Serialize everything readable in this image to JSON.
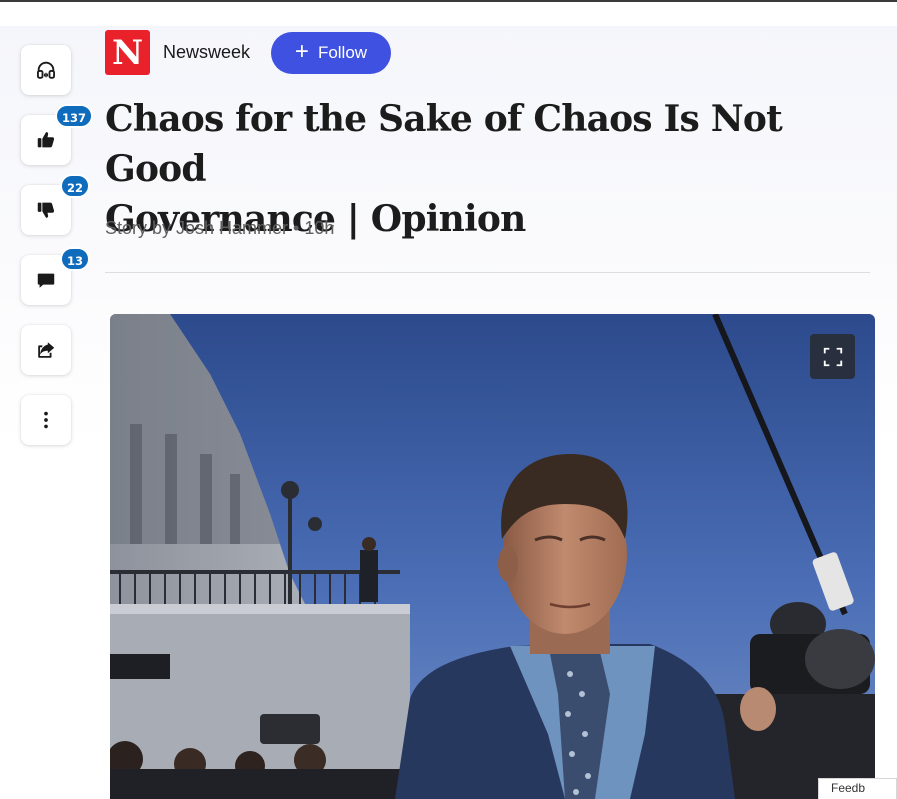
{
  "publisher": {
    "logo_letter": "N",
    "name": "Newsweek",
    "follow_label": "Follow",
    "brand_color": "#e8212a",
    "follow_color": "#3f51e0"
  },
  "article": {
    "headline_line1": "Chaos for the Sake of Chaos Is Not Good",
    "headline_line2": "Governance | Opinion",
    "byline": "Story by Josh Hammer • 10h"
  },
  "actions": {
    "listen_icon": "headphones-icon",
    "like_icon": "thumbs-up-icon",
    "like_count": "137",
    "dislike_icon": "thumbs-down-icon",
    "dislike_count": "22",
    "comment_icon": "comment-icon",
    "comment_count": "13",
    "share_icon": "share-icon",
    "more_icon": "more-vertical-icon",
    "badge_color": "#0f6cbd"
  },
  "media": {
    "expand_icon": "fullscreen-icon"
  },
  "bottom_chip": {
    "text": "Feedb"
  }
}
